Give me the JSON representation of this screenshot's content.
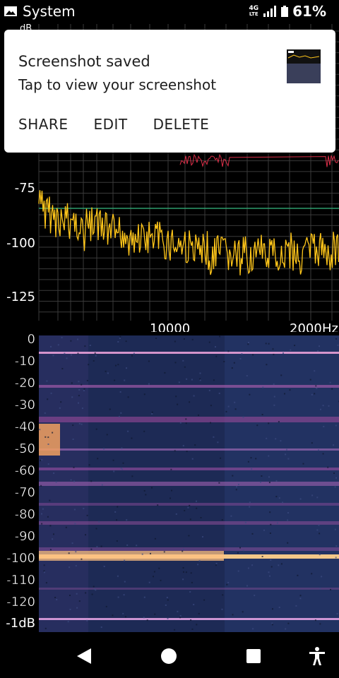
{
  "status": {
    "app": "System",
    "network": "4G",
    "network_sub": "LTE",
    "battery": "61%"
  },
  "notification": {
    "title": "Screenshot saved",
    "text": "Tap to view your screenshot",
    "actions": {
      "share": "SHARE",
      "edit": "EDIT",
      "delete": "DELETE"
    }
  },
  "spectrum": {
    "unit_label": "dB",
    "y_ticks": [
      {
        "label": "-75"
      },
      {
        "label": "-100"
      },
      {
        "label": "-125"
      }
    ],
    "x_ticks": [
      {
        "label": "10000"
      },
      {
        "label": "2000"
      }
    ],
    "x_unit": "Hz"
  },
  "spectrogram": {
    "db_ticks": [
      "0",
      "-10",
      "-20",
      "-30",
      "-40",
      "-50",
      "-60",
      "-70",
      "-80",
      "-90",
      "-100",
      "-110",
      "-120"
    ],
    "db_unit": "dB",
    "db_last_partial": "-1"
  },
  "colors": {
    "trace": "#ffc61a",
    "peak_trace": "#e0304a",
    "threshold": "#2f9e6e",
    "grid": "#444"
  },
  "nav": {
    "back": "back-icon",
    "home": "home-icon",
    "recents": "recents-icon",
    "accessibility": "accessibility-icon"
  }
}
